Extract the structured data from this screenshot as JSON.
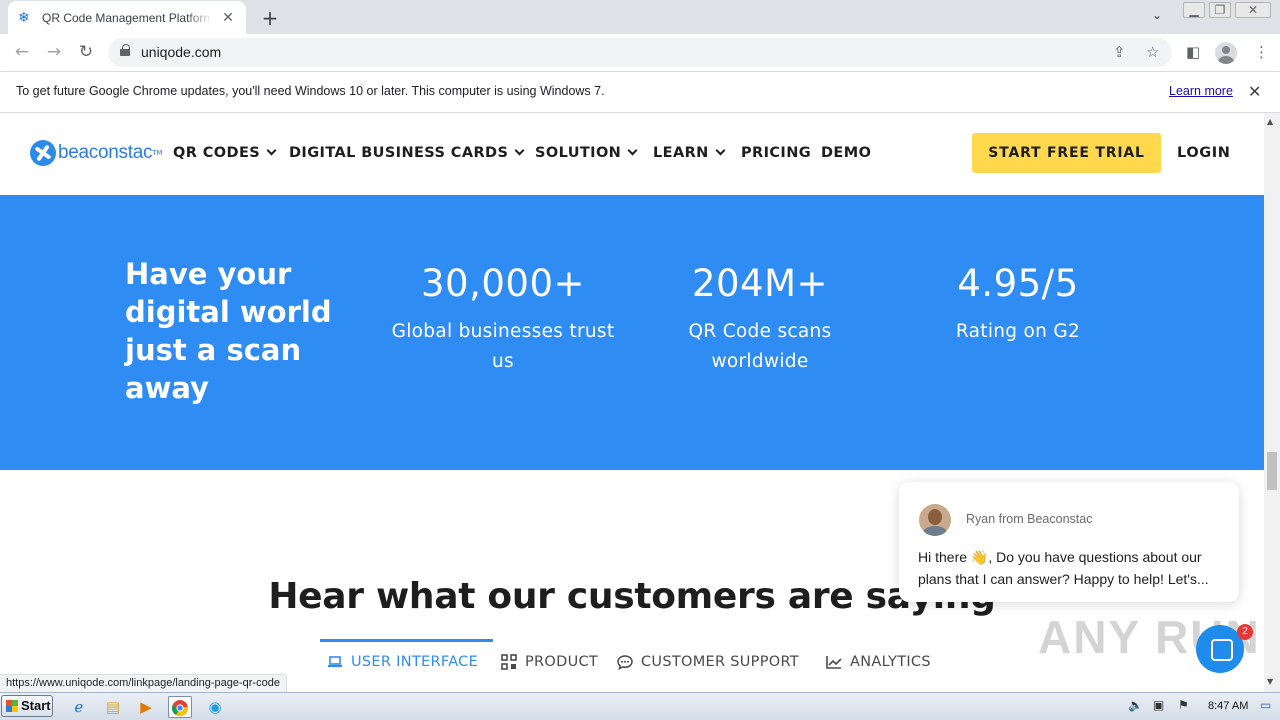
{
  "browser": {
    "tab_title": "QR Code Management Platform for m",
    "tab_close": "✕",
    "new_tab": "+",
    "tab_search": "⌄",
    "window_controls": [
      "▁",
      "❐",
      "✕"
    ],
    "url": "uniqode.com",
    "infobar_text": "To get future Google Chrome updates, you'll need Windows 10 or later. This computer is using Windows 7.",
    "infobar_link": "Learn more",
    "infobar_close": "✕",
    "status_url": "https://www.uniqode.com/linkpage/landing-page-qr-code"
  },
  "site": {
    "logo_text": "beaconstac",
    "logo_tm": "TM",
    "nav": [
      {
        "label": "QR CODES"
      },
      {
        "label": "DIGITAL BUSINESS CARDS"
      },
      {
        "label": "SOLUTION"
      },
      {
        "label": "LEARN"
      },
      {
        "label": "PRICING"
      },
      {
        "label": "DEMO"
      }
    ],
    "cta": "START FREE TRIAL",
    "login": "LOGIN"
  },
  "hero": {
    "title": "Have your digital world just a scan away",
    "stats": [
      {
        "value": "30,000+",
        "label": "Global businesses trust us"
      },
      {
        "value": "204M+",
        "label": "QR Code scans worldwide"
      },
      {
        "value": "4.95/5",
        "label": "Rating on G2"
      }
    ],
    "background": "#2f8cf2"
  },
  "testimonials": {
    "title": "Hear what our customers are saying",
    "tabs": [
      {
        "label": "USER INTERFACE",
        "icon": "laptop-icon",
        "active": true
      },
      {
        "label": "PRODUCT",
        "icon": "qr-grid-icon",
        "active": false
      },
      {
        "label": "CUSTOMER SUPPORT",
        "icon": "chat-bubble-icon",
        "active": false
      },
      {
        "label": "ANALYTICS",
        "icon": "trend-chart-icon",
        "active": false
      }
    ]
  },
  "chat": {
    "from": "Ryan from Beaconstac",
    "message": "Hi there 👋,  Do you have questions about our plans that I can answer? Happy to help! Let's...",
    "badge": "2"
  },
  "watermark": "ANY RUN",
  "taskbar": {
    "start": "Start",
    "clock": "8:47 AM"
  },
  "colors": {
    "accent": "#2f8cf2",
    "cta": "#ffd84d"
  }
}
